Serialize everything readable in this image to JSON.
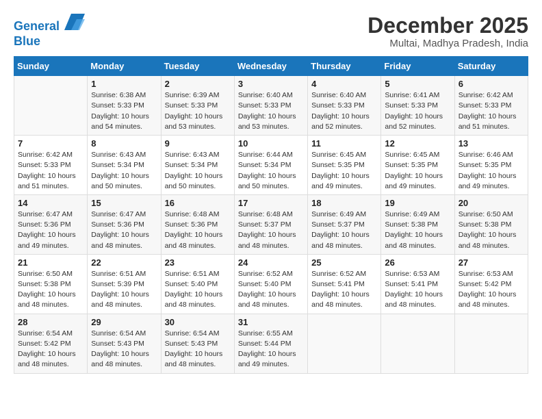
{
  "logo": {
    "line1": "General",
    "line2": "Blue"
  },
  "title": "December 2025",
  "subtitle": "Multai, Madhya Pradesh, India",
  "weekdays": [
    "Sunday",
    "Monday",
    "Tuesday",
    "Wednesday",
    "Thursday",
    "Friday",
    "Saturday"
  ],
  "weeks": [
    [
      {
        "day": "",
        "info": ""
      },
      {
        "day": "1",
        "info": "Sunrise: 6:38 AM\nSunset: 5:33 PM\nDaylight: 10 hours\nand 54 minutes."
      },
      {
        "day": "2",
        "info": "Sunrise: 6:39 AM\nSunset: 5:33 PM\nDaylight: 10 hours\nand 53 minutes."
      },
      {
        "day": "3",
        "info": "Sunrise: 6:40 AM\nSunset: 5:33 PM\nDaylight: 10 hours\nand 53 minutes."
      },
      {
        "day": "4",
        "info": "Sunrise: 6:40 AM\nSunset: 5:33 PM\nDaylight: 10 hours\nand 52 minutes."
      },
      {
        "day": "5",
        "info": "Sunrise: 6:41 AM\nSunset: 5:33 PM\nDaylight: 10 hours\nand 52 minutes."
      },
      {
        "day": "6",
        "info": "Sunrise: 6:42 AM\nSunset: 5:33 PM\nDaylight: 10 hours\nand 51 minutes."
      }
    ],
    [
      {
        "day": "7",
        "info": "Sunrise: 6:42 AM\nSunset: 5:33 PM\nDaylight: 10 hours\nand 51 minutes."
      },
      {
        "day": "8",
        "info": "Sunrise: 6:43 AM\nSunset: 5:34 PM\nDaylight: 10 hours\nand 50 minutes."
      },
      {
        "day": "9",
        "info": "Sunrise: 6:43 AM\nSunset: 5:34 PM\nDaylight: 10 hours\nand 50 minutes."
      },
      {
        "day": "10",
        "info": "Sunrise: 6:44 AM\nSunset: 5:34 PM\nDaylight: 10 hours\nand 50 minutes."
      },
      {
        "day": "11",
        "info": "Sunrise: 6:45 AM\nSunset: 5:35 PM\nDaylight: 10 hours\nand 49 minutes."
      },
      {
        "day": "12",
        "info": "Sunrise: 6:45 AM\nSunset: 5:35 PM\nDaylight: 10 hours\nand 49 minutes."
      },
      {
        "day": "13",
        "info": "Sunrise: 6:46 AM\nSunset: 5:35 PM\nDaylight: 10 hours\nand 49 minutes."
      }
    ],
    [
      {
        "day": "14",
        "info": "Sunrise: 6:47 AM\nSunset: 5:36 PM\nDaylight: 10 hours\nand 49 minutes."
      },
      {
        "day": "15",
        "info": "Sunrise: 6:47 AM\nSunset: 5:36 PM\nDaylight: 10 hours\nand 48 minutes."
      },
      {
        "day": "16",
        "info": "Sunrise: 6:48 AM\nSunset: 5:36 PM\nDaylight: 10 hours\nand 48 minutes."
      },
      {
        "day": "17",
        "info": "Sunrise: 6:48 AM\nSunset: 5:37 PM\nDaylight: 10 hours\nand 48 minutes."
      },
      {
        "day": "18",
        "info": "Sunrise: 6:49 AM\nSunset: 5:37 PM\nDaylight: 10 hours\nand 48 minutes."
      },
      {
        "day": "19",
        "info": "Sunrise: 6:49 AM\nSunset: 5:38 PM\nDaylight: 10 hours\nand 48 minutes."
      },
      {
        "day": "20",
        "info": "Sunrise: 6:50 AM\nSunset: 5:38 PM\nDaylight: 10 hours\nand 48 minutes."
      }
    ],
    [
      {
        "day": "21",
        "info": "Sunrise: 6:50 AM\nSunset: 5:38 PM\nDaylight: 10 hours\nand 48 minutes."
      },
      {
        "day": "22",
        "info": "Sunrise: 6:51 AM\nSunset: 5:39 PM\nDaylight: 10 hours\nand 48 minutes."
      },
      {
        "day": "23",
        "info": "Sunrise: 6:51 AM\nSunset: 5:40 PM\nDaylight: 10 hours\nand 48 minutes."
      },
      {
        "day": "24",
        "info": "Sunrise: 6:52 AM\nSunset: 5:40 PM\nDaylight: 10 hours\nand 48 minutes."
      },
      {
        "day": "25",
        "info": "Sunrise: 6:52 AM\nSunset: 5:41 PM\nDaylight: 10 hours\nand 48 minutes."
      },
      {
        "day": "26",
        "info": "Sunrise: 6:53 AM\nSunset: 5:41 PM\nDaylight: 10 hours\nand 48 minutes."
      },
      {
        "day": "27",
        "info": "Sunrise: 6:53 AM\nSunset: 5:42 PM\nDaylight: 10 hours\nand 48 minutes."
      }
    ],
    [
      {
        "day": "28",
        "info": "Sunrise: 6:54 AM\nSunset: 5:42 PM\nDaylight: 10 hours\nand 48 minutes."
      },
      {
        "day": "29",
        "info": "Sunrise: 6:54 AM\nSunset: 5:43 PM\nDaylight: 10 hours\nand 48 minutes."
      },
      {
        "day": "30",
        "info": "Sunrise: 6:54 AM\nSunset: 5:43 PM\nDaylight: 10 hours\nand 48 minutes."
      },
      {
        "day": "31",
        "info": "Sunrise: 6:55 AM\nSunset: 5:44 PM\nDaylight: 10 hours\nand 49 minutes."
      },
      {
        "day": "",
        "info": ""
      },
      {
        "day": "",
        "info": ""
      },
      {
        "day": "",
        "info": ""
      }
    ]
  ]
}
